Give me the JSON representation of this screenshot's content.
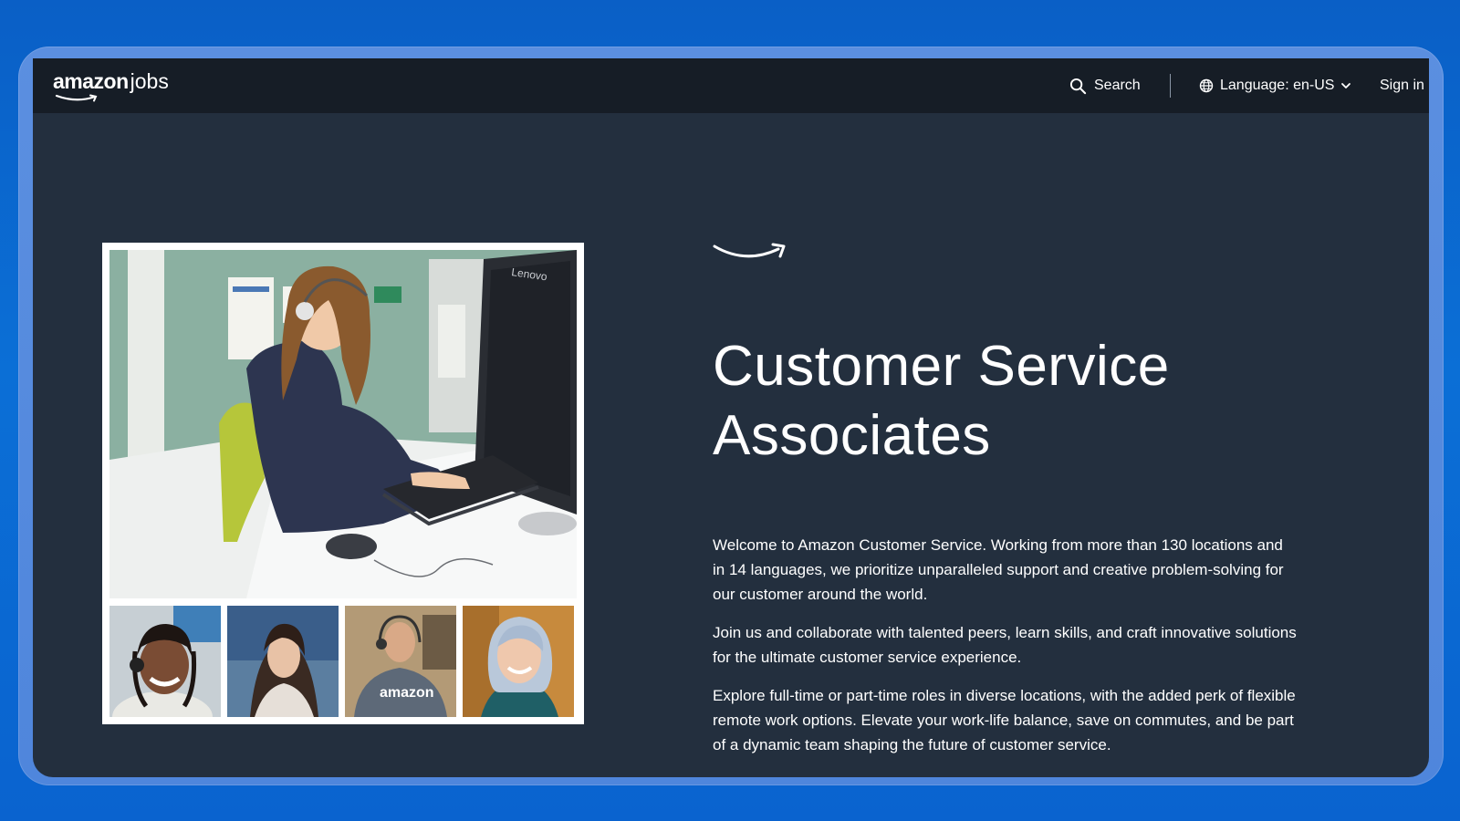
{
  "colors": {
    "background_blue": "#0b6fd6",
    "frame_blue": "#5b8fe0",
    "page_bg": "#232f3e",
    "topbar_bg": "#161d26",
    "text": "#ffffff",
    "smile_orange_white": "#ffffff"
  },
  "header": {
    "logo_amazon": "amazon",
    "logo_jobs": "jobs",
    "search_label": "Search",
    "search_icon": "search-icon",
    "language_label": "Language: en-US",
    "language_icon": "globe-icon",
    "language_chevron": "chevron-down-icon",
    "signin_label": "Sign in"
  },
  "hero": {
    "smile_icon": "amazon-smile-icon",
    "title_line1": "Customer Service",
    "title_line2": "Associates",
    "paragraph1": "Welcome to Amazon Customer Service. Working from more than 130 locations and in 14 languages, we prioritize unparalleled support and creative problem-solving for our customer around the world.",
    "paragraph2": "Join us and collaborate with talented peers, learn skills, and craft innovative solutions for the ultimate customer service experience.",
    "paragraph3": "Explore full-time or part-time roles in diverse locations, with the added perk of flexible remote work options. Elevate your work-life balance, save on commutes, and be part of a dynamic team shaping the future of customer service."
  },
  "photos": {
    "main": "associate-at-desk-photo",
    "main_monitor_text": "Lenovo",
    "thumb3_shirt_text": "amazon",
    "thumbs": [
      "associate-headset-photo",
      "associate-beach-photo",
      "associate-hoodie-photo",
      "associate-smiling-photo"
    ]
  }
}
